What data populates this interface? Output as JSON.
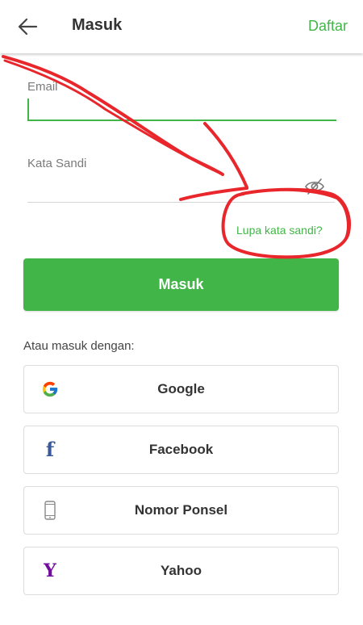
{
  "header": {
    "title": "Masuk",
    "register_label": "Daftar",
    "back_icon": "arrow-left-icon"
  },
  "form": {
    "email_label": "Email",
    "email_value": "",
    "password_label": "Kata Sandi",
    "password_value": "",
    "password_toggle_icon": "eye-slash-icon",
    "forgot_password": "Lupa kata sandi?",
    "submit_label": "Masuk"
  },
  "alternative": {
    "label": "Atau masuk dengan:",
    "providers": [
      {
        "label": "Google",
        "icon": "google-icon"
      },
      {
        "label": "Facebook",
        "icon": "facebook-icon"
      },
      {
        "label": "Nomor Ponsel",
        "icon": "phone-icon"
      },
      {
        "label": "Yahoo",
        "icon": "yahoo-icon"
      }
    ]
  },
  "colors": {
    "accent": "#42b549",
    "annotation": "#e8262b",
    "facebook": "#3b5998",
    "yahoo": "#720e9e"
  },
  "icons": {
    "facebook_glyph": "f",
    "yahoo_glyph": "Y"
  }
}
